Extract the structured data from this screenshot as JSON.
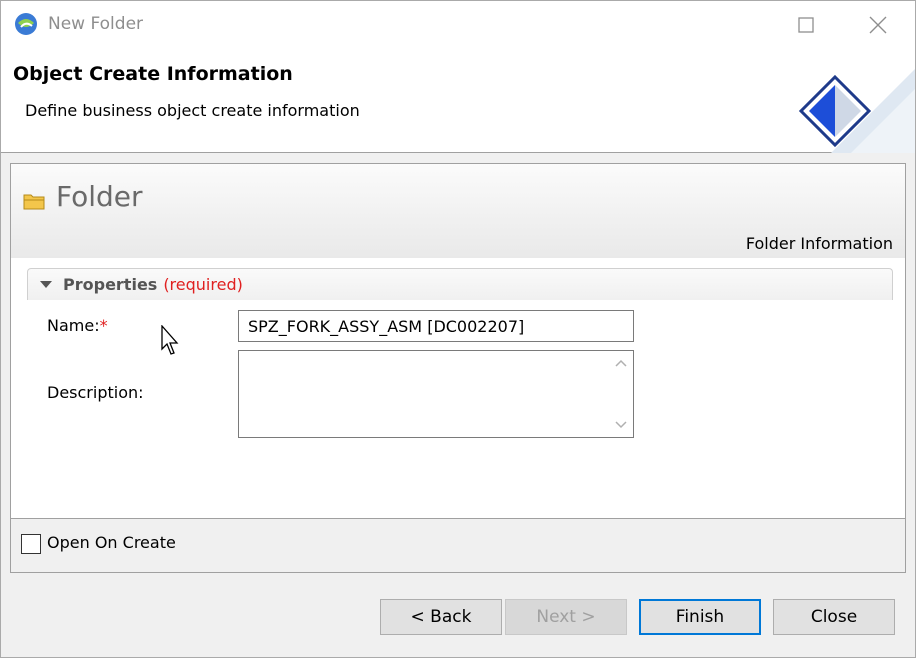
{
  "window": {
    "title": "New Folder"
  },
  "banner": {
    "title": "Object Create Information",
    "description": "Define business object create information"
  },
  "form": {
    "header_title": "Folder",
    "info_label": "Folder Information",
    "section": {
      "label": "Properties",
      "required": "(required)"
    },
    "name": {
      "label": "Name:",
      "required_mark": "*",
      "value": "SPZ_FORK_ASSY_ASM [DC002207]"
    },
    "description": {
      "label": "Description:",
      "value": ""
    },
    "open_on_create": {
      "label": "Open On Create",
      "checked": false
    }
  },
  "buttons": {
    "back": "< Back",
    "next": "Next >",
    "finish": "Finish",
    "close": "Close"
  },
  "icons": {
    "app": "teamcenter-icon",
    "folder": "folder-icon",
    "banner": "wizard-diamond-icon"
  },
  "colors": {
    "required": "#e02020",
    "default_button_border": "#0078d7"
  }
}
